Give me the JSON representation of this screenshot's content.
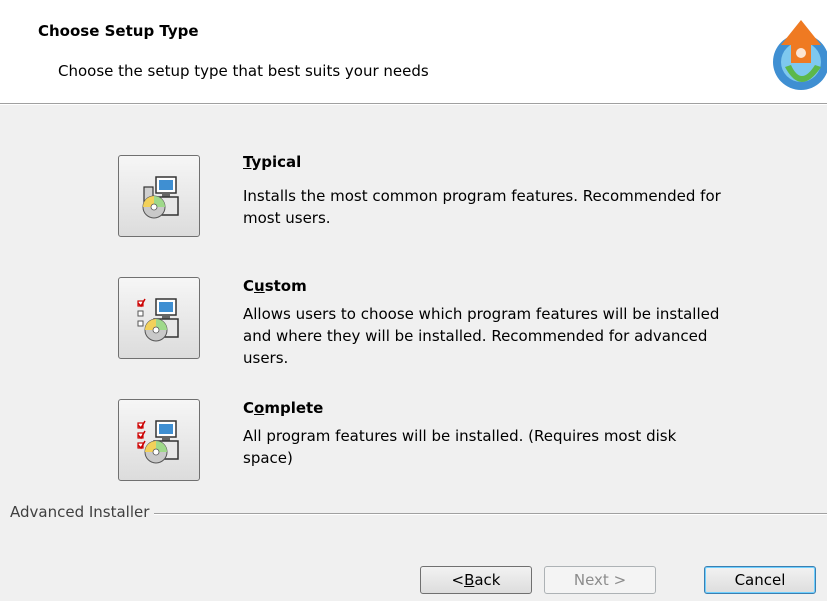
{
  "header": {
    "title": "Choose Setup Type",
    "subtitle": "Choose the setup type that best suits your needs"
  },
  "options": [
    {
      "id": "typical",
      "title_pre": "",
      "title_key": "T",
      "title_post": "ypical",
      "description_lines": [
        "Installs the most common program features. Recommended for",
        "most users."
      ]
    },
    {
      "id": "custom",
      "title_pre": "C",
      "title_key": "u",
      "title_post": "stom",
      "description_lines": [
        "Allows users to choose which program features will be installed",
        "and where they will be installed. Recommended for advanced",
        "users."
      ]
    },
    {
      "id": "complete",
      "title_pre": "C",
      "title_key": "o",
      "title_post": "mplete",
      "description_lines": [
        "All program features will be installed.  (Requires most disk",
        "space)"
      ]
    }
  ],
  "footer": {
    "brand": "Advanced Installer"
  },
  "buttons": {
    "back_pre": "< ",
    "back_key": "B",
    "back_post": "ack",
    "next": "Next >",
    "cancel": "Cancel"
  },
  "icons": {
    "logo": "advanced-installer-logo-icon",
    "typical": "computer-cd-icon",
    "custom": "checklist-computer-cd-icon",
    "complete": "full-checklist-computer-cd-icon"
  },
  "colors": {
    "header_bg": "#ffffff",
    "body_bg": "#f0f0f0",
    "default_button_border": "#3c7fb1",
    "disabled_text": "#8c8c8c"
  }
}
